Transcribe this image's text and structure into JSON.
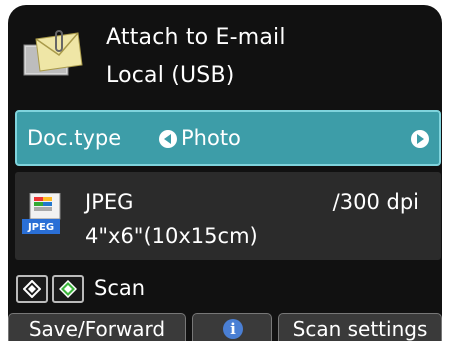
{
  "header": {
    "title_line1": "Attach to E-mail",
    "title_line2": "Local (USB)",
    "icon": "attach-to-email-icon"
  },
  "doctype": {
    "label": "Doc.type",
    "value": "Photo",
    "accent_color": "#3d9da8"
  },
  "file_info": {
    "format": "JPEG",
    "resolution": "/300 dpi",
    "size": "4\"x6\"(10x15cm)",
    "icon": "jpeg-file-icon",
    "icon_text": "JPEG"
  },
  "scan": {
    "label": "Scan",
    "black_key_icon": "black-start-icon",
    "color_key_icon": "color-start-icon"
  },
  "softkeys": {
    "left": "Save/Forward",
    "center_icon": "info-icon",
    "center_text": "i",
    "right": "Scan settings"
  }
}
